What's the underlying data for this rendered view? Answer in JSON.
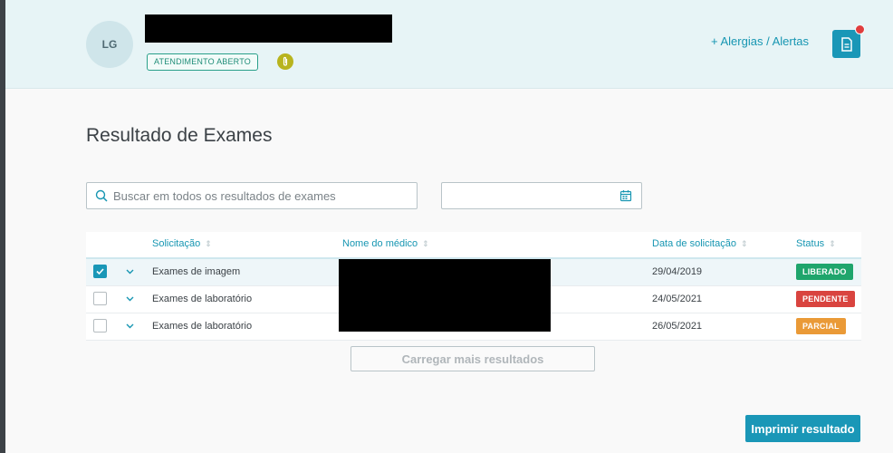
{
  "header": {
    "avatar_initials": "LG",
    "status_label": "ATENDIMENTO ABERTO",
    "allergies_link": "+ Alergias / Alertas"
  },
  "page": {
    "title": "Resultado de Exames"
  },
  "filters": {
    "search_placeholder": "Buscar em todos os resultados de exames",
    "date_value": ""
  },
  "table": {
    "columns": {
      "solicitacao": "Solicitação",
      "medico": "Nome do médico",
      "data": "Data de solicitação",
      "status": "Status"
    },
    "sort_icon": "⇕",
    "rows": [
      {
        "solicitacao": "Exames de imagem",
        "data": "29/04/2019",
        "status": "LIBERADO",
        "status_color": "#1fa56c",
        "checked": true
      },
      {
        "solicitacao": "Exames de laboratório",
        "data": "24/05/2021",
        "status": "PENDENTE",
        "status_color": "#d9443f",
        "checked": false
      },
      {
        "solicitacao": "Exames de laboratório",
        "data": "26/05/2021",
        "status": "PARCIAL",
        "status_color": "#ea9a37",
        "checked": false
      }
    ]
  },
  "actions": {
    "load_more": "Carregar mais resultados",
    "print": "Imprimir resultado"
  },
  "colors": {
    "accent": "#1a97b7",
    "header_bg": "#e7f4f6"
  }
}
